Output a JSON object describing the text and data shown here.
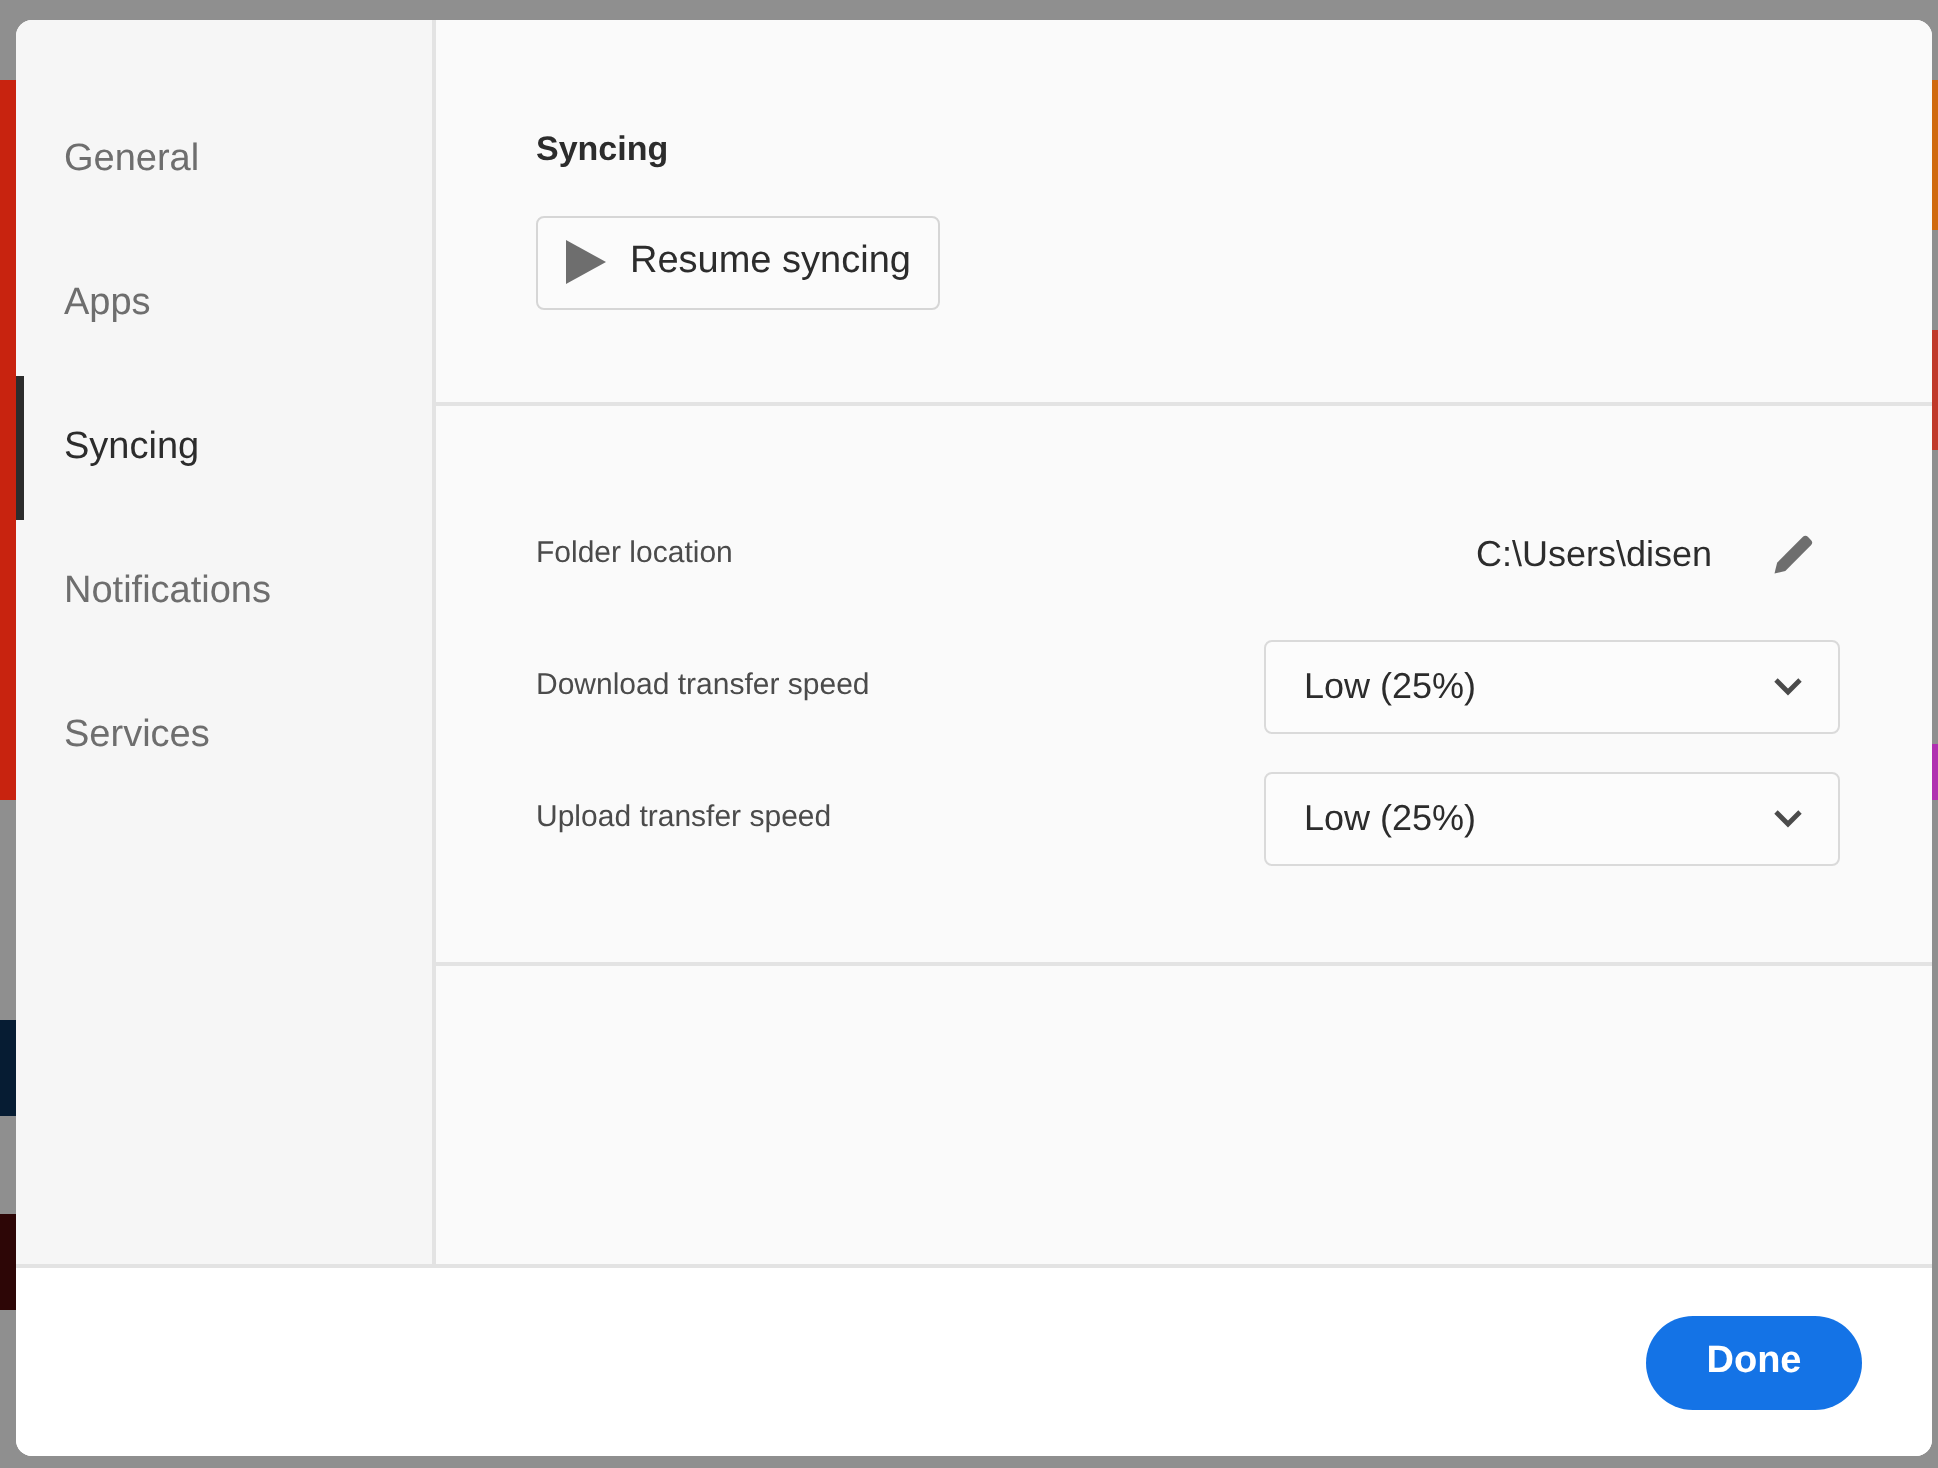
{
  "sidebar": {
    "items": [
      {
        "label": "General",
        "selected": false
      },
      {
        "label": "Apps",
        "selected": false
      },
      {
        "label": "Syncing",
        "selected": true
      },
      {
        "label": "Notifications",
        "selected": false
      },
      {
        "label": "Services",
        "selected": false
      }
    ]
  },
  "syncing": {
    "title": "Syncing",
    "resume_button": "Resume syncing"
  },
  "settings": [
    {
      "kind": "path",
      "label": "Folder location",
      "value": "C:\\Users\\disen"
    },
    {
      "kind": "dropdown",
      "label": "Download transfer speed",
      "value": "Low (25%)"
    },
    {
      "kind": "dropdown",
      "label": "Upload transfer speed",
      "value": "Low (25%)"
    }
  ],
  "buttons": {
    "done": "Done"
  }
}
